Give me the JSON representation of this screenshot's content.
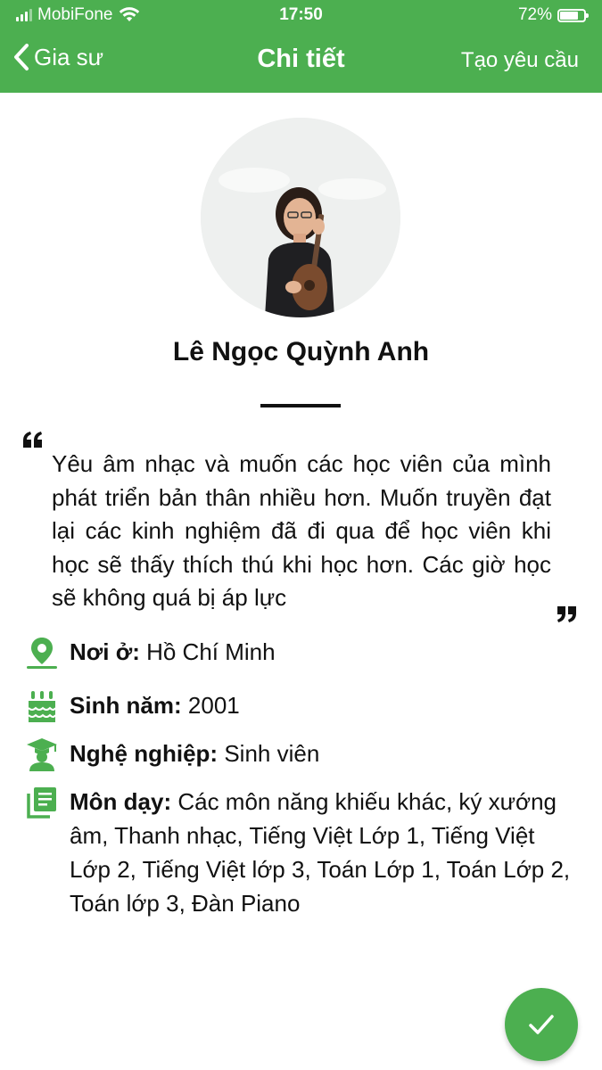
{
  "status_bar": {
    "carrier": "MobiFone",
    "time": "17:50",
    "battery": "72%",
    "battery_level": 0.72
  },
  "nav": {
    "back_label": "Gia sư",
    "title": "Chi tiết",
    "action_label": "Tạo yêu cầu"
  },
  "profile": {
    "name": "Lê Ngọc Quỳnh Anh",
    "quote": "Yêu âm nhạc và muốn các học viên của mình phát triển bản thân nhiều hơn. Muốn truyền đạt lại các kinh nghiệm đã đi qua để học viên khi học sẽ thấy thích thú khi học hơn. Các giờ học sẽ không quá bị áp lực"
  },
  "info": {
    "location_label": "Nơi ở:",
    "location_value": "Hồ Chí Minh",
    "birth_label": "Sinh năm:",
    "birth_value": "2001",
    "job_label": "Nghệ nghiệp:",
    "job_value": "Sinh viên",
    "subjects_label": "Môn dạy:",
    "subjects_value": "Các môn năng khiếu khác, ký xướng âm, Thanh nhạc, Tiếng Việt Lớp 1, Tiếng Việt Lớp 2, Tiếng Việt lớp 3, Toán Lớp 1, Toán Lớp 2, Toán lớp 3, Đàn Piano"
  },
  "colors": {
    "accent": "#4caf50",
    "text": "#111111"
  },
  "icons": {
    "back": "chevron-left-icon",
    "location": "map-pin-icon",
    "birth": "birthday-cake-icon",
    "job": "graduate-icon",
    "subjects": "library-books-icon",
    "confirm": "check-icon"
  }
}
